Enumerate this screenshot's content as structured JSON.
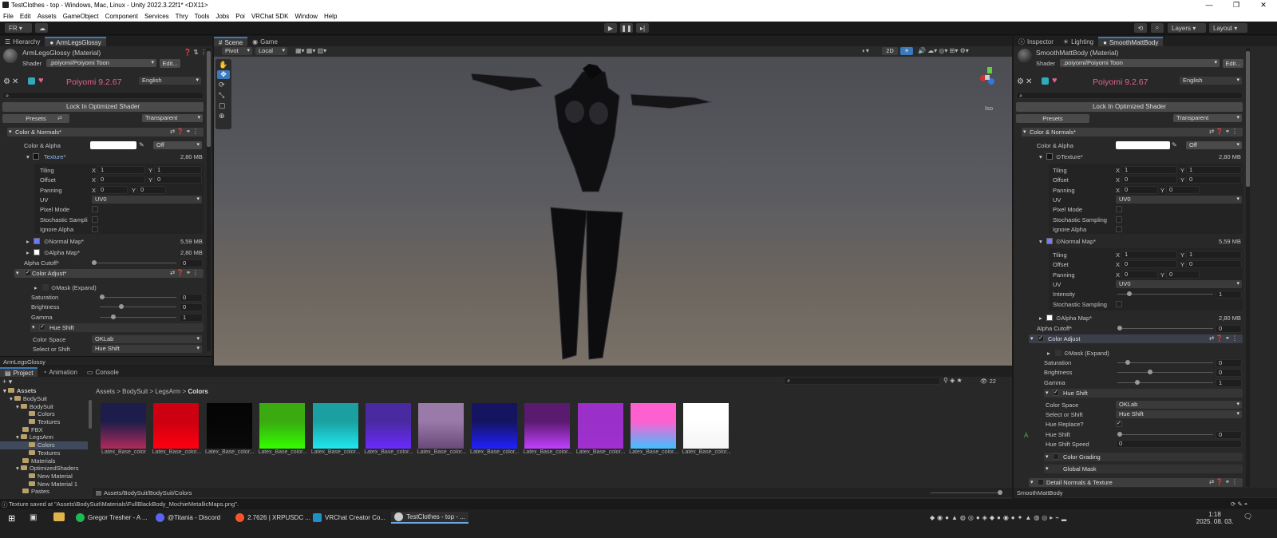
{
  "window": {
    "title": "TestClothes - top - Windows, Mac, Linux - Unity 2022.3.22f1* <DX11>",
    "controls": [
      "—",
      "❐",
      "✕"
    ]
  },
  "menu": [
    "File",
    "Edit",
    "Assets",
    "GameObject",
    "Component",
    "Services",
    "Thry",
    "Tools",
    "Jobs",
    "Poi",
    "VRChat SDK",
    "Window",
    "Help"
  ],
  "toolbar": {
    "account": "FR",
    "layers": "Layers",
    "layout": "Layout"
  },
  "hierarchy": {
    "tab": "Hierarchy",
    "tab2": "ArmLegsGlossy"
  },
  "left_inspector": {
    "material": "ArmLegsGlossy (Material)",
    "shader_label": "Shader",
    "shader": ".poiyomi/Poiyomi Toon",
    "edit": "Edit...",
    "version": "Poiyomi 9.2.67",
    "language": "English",
    "lock": "Lock In Optimized Shader",
    "presets": "Presets",
    "render_mode": "Transparent",
    "section": "Color & Normals*",
    "color_alpha": "Color & Alpha",
    "color_alpha_mode": "Off",
    "texture": "Texture*",
    "texture_size": "2,80 MB",
    "tiling": "Tiling",
    "offset": "Offset",
    "panning": "Panning",
    "uv": "UV",
    "uv_value": "UV0",
    "pixel_mode": "Pixel Mode",
    "stochastic": "Stochastic Sampli",
    "ignore_alpha": "Ignore Alpha",
    "x": "X",
    "y": "Y",
    "tiling_x": "1",
    "tiling_y": "1",
    "offset_x": "0",
    "offset_y": "0",
    "panning_x": "0",
    "panning_y": "0",
    "normal_map": "Normal Map*",
    "normal_size": "5,59 MB",
    "alpha_map": "Alpha Map*",
    "alpha_size": "2,80 MB",
    "alpha_cutoff": "Alpha Cutoff*",
    "alpha_cutoff_value": "0",
    "alpha_cutoff_level": 0.0,
    "color_adjust": "Color Adjust*",
    "mask": "Mask (Expand)",
    "saturation": "Saturation",
    "saturation_value": "0",
    "saturation_level": 0.0,
    "brightness": "Brightness",
    "brightness_value": "0",
    "brightness_level": 0.25,
    "gamma": "Gamma",
    "gamma_value": "1",
    "gamma_level": 0.15,
    "hue_shift": "Hue Shift",
    "color_space": "Color Space",
    "color_space_value": "OKLab",
    "select_shift": "Select or Shift",
    "select_shift_value": "Hue Shift",
    "footer": "ArmLegsGlossy"
  },
  "scene": {
    "tabs": [
      "Scene",
      "Game"
    ],
    "pivot": "Pivot",
    "local": "Local",
    "mode2d": "2D",
    "iso": "Iso"
  },
  "project": {
    "tabs": [
      "Project",
      "Animation",
      "Console"
    ],
    "tree": [
      "Assets",
      "BodySuit",
      "BodySuit",
      "Colors",
      "Textures",
      "FBX",
      "LegsArm",
      "Colors",
      "Textures",
      "Materials",
      "OptimizedShaders",
      "New Material",
      "New Material 1",
      "Pastes"
    ],
    "breadcrumb": [
      "Assets",
      "BodySuit",
      "LegsArm",
      "Colors"
    ],
    "count": "22",
    "path": "Assets/BodySuit/BodySuit/Colors",
    "thumbs": [
      {
        "caption": "Latex_Base_color",
        "top": "#1c1d4a",
        "bottom": "#b02a5a"
      },
      {
        "caption": "Latex_Base_color...",
        "top": "#cc0010",
        "bottom": "#ff0010"
      },
      {
        "caption": "Latex_Base_color...",
        "top": "#050505",
        "bottom": "#0a0a0a"
      },
      {
        "caption": "Latex_Base_color...",
        "top": "#3aaa10",
        "bottom": "#33ff00"
      },
      {
        "caption": "Latex_Base_color...",
        "top": "#1aa0a0",
        "bottom": "#20e8f0"
      },
      {
        "caption": "Latex_Base_color...",
        "top": "#4a2aa0",
        "bottom": "#6a2aff"
      },
      {
        "caption": "Latex_Base_color...",
        "top": "#9a7aa8",
        "bottom": "#6a4a78"
      },
      {
        "caption": "Latex_Base_color...",
        "top": "#141460",
        "bottom": "#2020ff"
      },
      {
        "caption": "Latex_Base_color...",
        "top": "#5a1a70",
        "bottom": "#c040ff"
      },
      {
        "caption": "Latex_Base_color...",
        "top": "#9a30c8",
        "bottom": "#a030d0"
      },
      {
        "caption": "Latex_Base_color...",
        "top": "#ff60d0",
        "bottom": "#40c0ff"
      },
      {
        "caption": "Latex_Base_color...",
        "top": "#ffffff",
        "bottom": "#f4f4f4"
      }
    ]
  },
  "right_inspector": {
    "tabs": [
      "Inspector",
      "Lighting",
      "SmoothMattBody"
    ],
    "material": "SmoothMattBody (Material)",
    "shader_label": "Shader",
    "shader": ".poiyomi/Poiyomi Toon",
    "edit": "Edit...",
    "version": "Poiyomi 9.2.67",
    "language": "English",
    "lock": "Lock In Optimized Shader",
    "presets": "Presets",
    "render_mode": "Transparent",
    "section": "Color & Normals*",
    "color_alpha": "Color & Alpha",
    "color_alpha_mode": "Off",
    "texture": "Texture*",
    "texture_size": "2,80 MB",
    "tiling": "Tiling",
    "offset": "Offset",
    "panning": "Panning",
    "uv": "UV",
    "uv_value": "UV0",
    "pixel_mode": "Pixel Mode",
    "stochastic": "Stochastic Sampling",
    "ignore_alpha": "Ignore Alpha",
    "x": "X",
    "y": "Y",
    "tiling_x": "1",
    "tiling_y": "1",
    "offset_x": "0",
    "offset_y": "0",
    "panning_x": "0",
    "panning_y": "0",
    "normal_map": "Normal Map*",
    "normal_size": "5,59 MB",
    "n_tiling_x": "1",
    "n_tiling_y": "1",
    "n_offset_x": "0",
    "n_offset_y": "0",
    "n_panning_x": "0",
    "n_panning_y": "0",
    "intensity": "Intensity",
    "intensity_value": "1",
    "intensity_level": 0.1,
    "alpha_map": "Alpha Map*",
    "alpha_size": "2,80 MB",
    "alpha_cutoff": "Alpha Cutoff*",
    "alpha_cutoff_value": "0",
    "color_adjust": "Color Adjust",
    "mask": "Mask (Expand)",
    "saturation": "Saturation",
    "saturation_value": "0",
    "brightness": "Brightness",
    "brightness_value": "0",
    "gamma": "Gamma",
    "gamma_value": "1",
    "hue_shift": "Hue Shift",
    "color_space": "Color Space",
    "color_space_value": "OKLab",
    "select_shift": "Select or Shift",
    "select_shift_value": "Hue Shift",
    "hue_replace": "Hue Replace?",
    "hue_shift_val_label": "Hue Shift",
    "hue_shift_value": "0",
    "hue_shift_speed": "Hue Shift Speed",
    "hue_shift_speed_value": "0",
    "color_grading": "Color Grading",
    "global_mask": "Global Mask",
    "detail": "Detail Normals & Texture",
    "footer": "SmoothMattBody",
    "side_mark": "A"
  },
  "status": {
    "message": "Texture saved at \"Assets\\BodySuit\\Materials\\FullBlackBody_MochieMetallicMaps.png\"."
  },
  "taskbar": {
    "items": [
      "Gregor Tresher - A ...",
      "@Titania - Discord",
      "2.7626 | XRPUSDC ...",
      "VRChat Creator Co...",
      "TestClothes - top - ..."
    ],
    "time": "1:18",
    "date": "2025. 08. 03."
  },
  "colors": {
    "accent": "#3a79bb",
    "poiyomi": "#e2608f",
    "bg": "#282828"
  }
}
